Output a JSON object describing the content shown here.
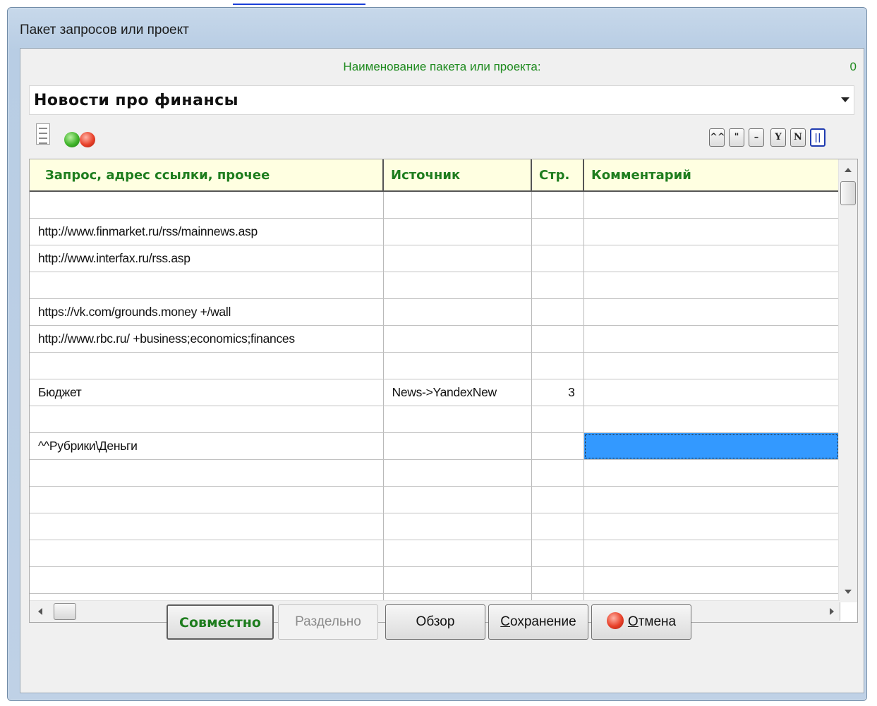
{
  "dialog": {
    "title": "Пакет запросов или проект",
    "name_label": "Наименование пакета или проекта:",
    "counter": "0",
    "project_name": "Новости про финансы"
  },
  "icons": {
    "document": "document-icon",
    "green": "green-circle-icon",
    "red": "red-circle-icon"
  },
  "toolbar": {
    "buttons": [
      {
        "label": "^^",
        "name": "caret-button"
      },
      {
        "label": "\"",
        "name": "quote-button"
      },
      {
        "label": "–",
        "name": "minus-button"
      },
      {
        "label": "Y",
        "name": "y-button"
      },
      {
        "label": "N",
        "name": "n-button"
      },
      {
        "label": "||",
        "name": "pause-button"
      }
    ]
  },
  "grid": {
    "headers": [
      "Запрос, адрес ссылки, прочее",
      "Источник",
      "Стр.",
      "Комментарий"
    ],
    "rows": [
      [
        "",
        "",
        "",
        ""
      ],
      [
        "http://www.finmarket.ru/rss/mainnews.asp",
        "",
        "",
        ""
      ],
      [
        "http://www.interfax.ru/rss.asp",
        "",
        "",
        ""
      ],
      [
        "",
        "",
        "",
        ""
      ],
      [
        "https://vk.com/grounds.money +/wall",
        "",
        "",
        ""
      ],
      [
        "http://www.rbc.ru/ +business;economics;finances",
        "",
        "",
        ""
      ],
      [
        "",
        "",
        "",
        ""
      ],
      [
        "Бюджет",
        "News->YandexNew",
        "3",
        ""
      ],
      [
        "",
        "",
        "",
        ""
      ],
      [
        "^^Рубрики\\Деньги",
        "",
        "",
        ""
      ],
      [
        "",
        "",
        "",
        ""
      ],
      [
        "",
        "",
        "",
        ""
      ],
      [
        "",
        "",
        "",
        ""
      ],
      [
        "",
        "",
        "",
        ""
      ],
      [
        "",
        "",
        "",
        ""
      ],
      [
        "",
        "",
        "",
        ""
      ]
    ],
    "selected_cell": {
      "row": 9,
      "col": 3
    }
  },
  "buttons": {
    "joint": "Совместно",
    "separate": "Раздельно",
    "browse": "Обзор",
    "save_first": "С",
    "save_rest": "охранение",
    "cancel_first": "О",
    "cancel_rest": "тмена"
  },
  "colors": {
    "label_green": "#1e8a1e",
    "header_bg": "#ffffe1",
    "selection": "#3399ff"
  }
}
